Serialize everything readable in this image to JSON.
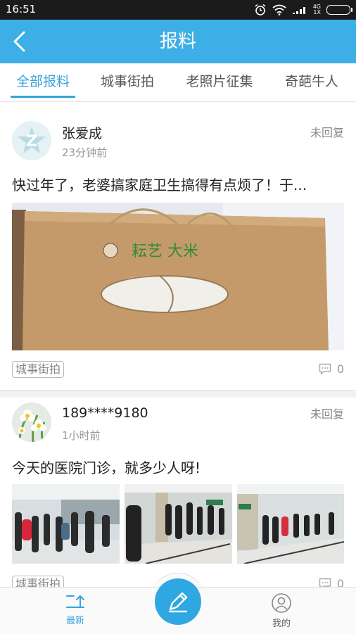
{
  "status_bar": {
    "time": "16:51",
    "network": "4G",
    "network_sub": "1X"
  },
  "header": {
    "title": "报料"
  },
  "tabs": [
    {
      "label": "全部报料",
      "active": true
    },
    {
      "label": "城事街拍",
      "active": false
    },
    {
      "label": "老照片征集",
      "active": false
    },
    {
      "label": "奇葩牛人",
      "active": false
    }
  ],
  "posts": [
    {
      "user": "张爱成",
      "time": "23分钟前",
      "status": "未回复",
      "text": "快过年了，老婆搞家庭卫生搞得有点烦了！于...",
      "image_text": "耘艺 大米",
      "tag": "城事街拍",
      "comments": "0"
    },
    {
      "user": "189****9180",
      "time": "1小时前",
      "status": "未回复",
      "text": "今天的医院门诊，就多少人呀!",
      "tag": "城事街拍",
      "comments": "0"
    }
  ],
  "bottom_nav": {
    "latest": "最新",
    "mine": "我的"
  },
  "colors": {
    "accent": "#3daee6",
    "tab_active": "#3aa3dc"
  }
}
